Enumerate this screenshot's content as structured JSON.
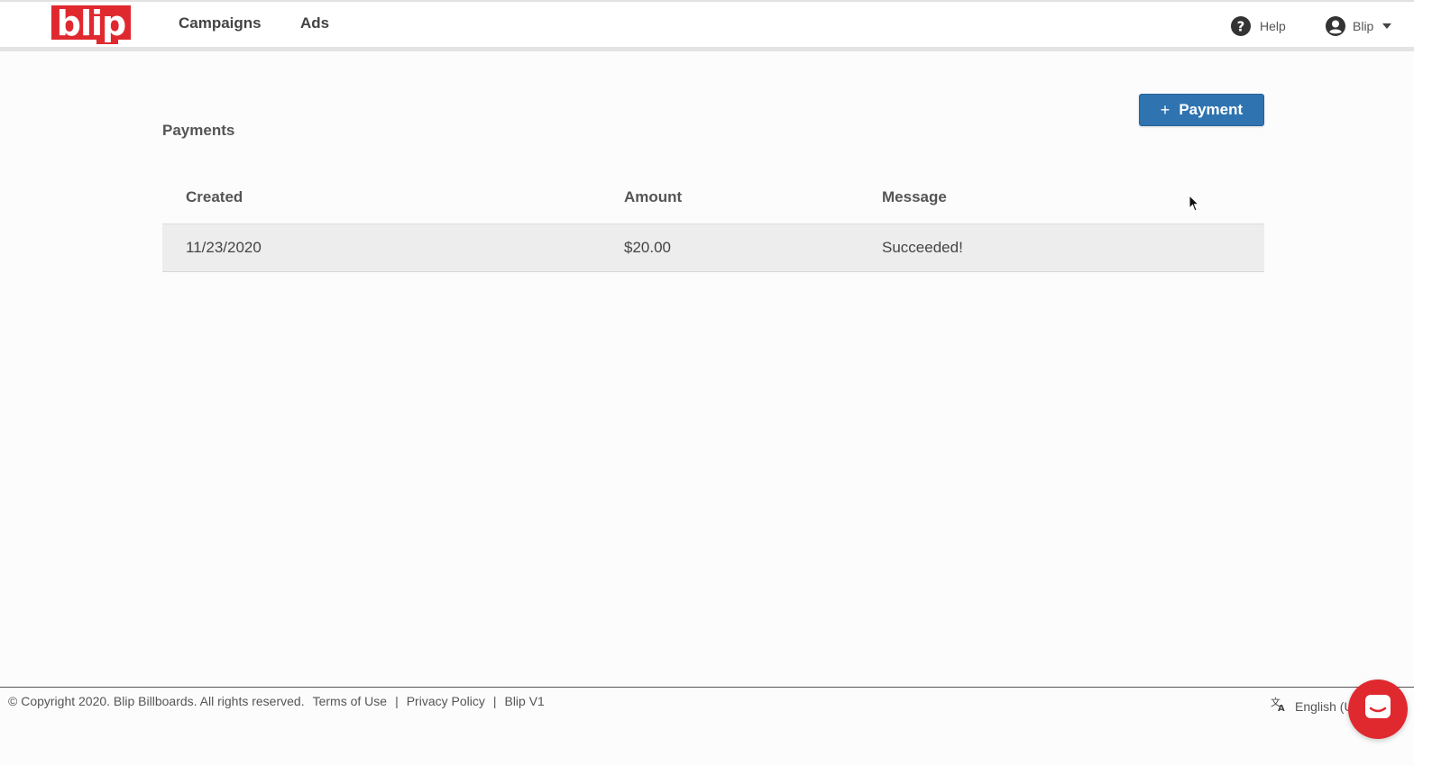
{
  "header": {
    "logo_text": "blip",
    "nav": [
      {
        "label": "Campaigns"
      },
      {
        "label": "Ads"
      }
    ],
    "help_label": "Help",
    "user_label": "Blip"
  },
  "main": {
    "title": "Payments",
    "add_button_label": "Payment",
    "table": {
      "columns": [
        "Created",
        "Amount",
        "Message"
      ],
      "rows": [
        {
          "created": "11/23/2020",
          "amount": "$20.00",
          "message": "Succeeded!"
        }
      ]
    }
  },
  "footer": {
    "copyright": "© Copyright 2020. Blip Billboards. All rights reserved.",
    "links": [
      "Terms of Use",
      "Privacy Policy",
      "Blip V1"
    ],
    "language": "English (U"
  },
  "colors": {
    "brand": "#e0292f",
    "button": "#2f74b0"
  },
  "icons": {
    "help": "question-circle-icon",
    "user": "user-circle-icon",
    "language": "translate-icon",
    "chat": "chat-icon"
  }
}
